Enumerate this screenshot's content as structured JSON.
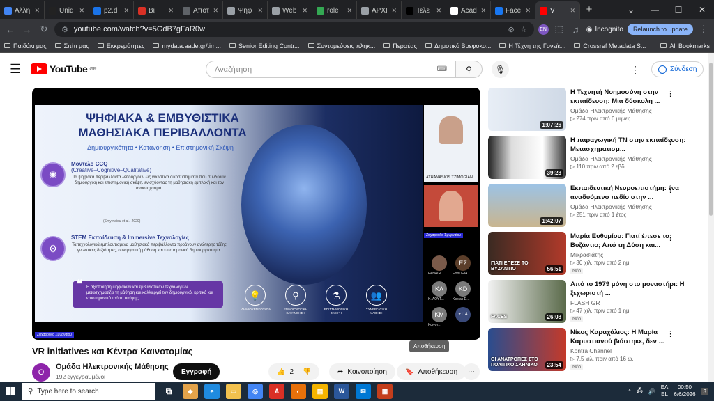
{
  "browser": {
    "tabs": [
      {
        "label": "Αλλη",
        "color": "#4285f4"
      },
      {
        "label": "Uniq",
        "color": "#222222"
      },
      {
        "label": "p2.d",
        "color": "#1a73e8"
      },
      {
        "label": "Βι",
        "color": "#d93025"
      },
      {
        "label": "Αποτ",
        "color": "#5f6368"
      },
      {
        "label": "Ψηφ",
        "color": "#9aa0a6"
      },
      {
        "label": "Web",
        "color": "#9aa0a6"
      },
      {
        "label": "role",
        "color": "#34a853"
      },
      {
        "label": "ΑΡΧΙ",
        "color": "#9aa0a6"
      },
      {
        "label": "Τελε",
        "color": "#000000"
      },
      {
        "label": "Acad",
        "color": "#ffffff"
      },
      {
        "label": "Face",
        "color": "#1877f2"
      },
      {
        "label": "V",
        "color": "#ff0000"
      }
    ],
    "url": "youtube.com/watch?v=5GdB7gFaR0w",
    "profile_badge": "EN",
    "incognito_label": "Incognito",
    "relaunch_label": "Relaunch to update",
    "bookmarks": [
      "Παιδάκι μας",
      "Σπίτι μας",
      "Εκκρεμότητες",
      "mydata.aade.gr/tim...",
      "Senior Editing Contr...",
      "Συντομεύσεις πληκ...",
      "Περσέας",
      "Δημοτικό Βρεφοκο...",
      "Η Τέχνη της Γονεϊκ...",
      "Crossref Metadata S..."
    ],
    "all_bookmarks": "All Bookmarks"
  },
  "youtube": {
    "logo_text": "YouTube",
    "region": "GR",
    "search_placeholder": "Αναζήτηση",
    "signin": "Σύνδεση"
  },
  "slide": {
    "title": "ΨΗΦΙΑΚΑ & ΕΜΒΥΘΙΣΤΙΚΑ ΜΑΘΗΣΙΑΚΑ ΠΕΡΙΒΑΛΛΟΝΤΑ",
    "subtitle": "Δημιουργικότητα • Κατανόηση • Επιστημονική Σκέψη",
    "model_head": "Μοντέλο CCQ",
    "model_sub": "(Creative–Cognitive–Qualitative)",
    "model_text": "Τα ψηφιακά περιβάλλοντα λειτουργούν ως γνωστικά οικοσυστήματα που συνδέουν δημιουργική και επιστημονική σκέψη, ενισχύοντας τη μαθησιακή εμπλοκή και τον αναστοχασμό.",
    "citation": "(Smyrnaiou et al., 2020)",
    "stem_head": "STEM Εκπαίδευση & Immersive Τεχνολογίες",
    "stem_text": "Τα τεχνολογικά εμπλουτισμένα μαθησιακά περιβάλλοντα προάγουν ανώτερης τάξης γνωστικές δεξιότητες, συνεργατική μάθηση και επιστημονική δημιουργικότητα.",
    "quote": "Η αξιοποίηση ψηφιακών και εμβυθιστικών τεχνολογιών μετασχηματίζει τη μάθηση και καλλιεργεί τον δημιουργικό, κριτικό και επιστημονικό τρόπο σκέψης.",
    "icons": [
      "ΔΗΜΙΟΥΡΓΙΚΟΤΗΤΑ",
      "ΕΝΝΟΙΟΛΟΓΙΚΗ ΚΑΤΑΝΟΗΣΗ",
      "ΕΠΙΣΤΗΜΟΝΙΚΗ ΣΚΕΨΗ",
      "ΣΥΝΕΡΓΑΤΙΚΗ ΜΑΘΗΣΗ"
    ],
    "presenter_tag": "Ζαχαρούλα Σμυρναίου"
  },
  "participants": {
    "p1": "ATHANASIOS TZIMOGIAN...",
    "p2": "Ζαχαρούλα Σμυρναίου",
    "avatars": [
      {
        "initials": "ΕΣ",
        "name": "ΕΥΔΟΞΙΑ...",
        "color": "#5b3e2a"
      },
      {
        "initials": "ΚΛ",
        "name": "Κ. ΛΟΥΤ...",
        "color": "#7a7a7a"
      },
      {
        "initials": "KD",
        "name": "Kostas D...",
        "color": "#7a7a7a"
      },
      {
        "initials": "KM",
        "name": "Κωνστ...",
        "color": "#7a7a7a"
      }
    ],
    "panag": "PANAGI...",
    "more": "+114"
  },
  "video": {
    "title": "VR initiatives και Κέντρα Καινοτομίας",
    "channel": "Ομάδα Ηλεκτρονικής Μάθησης",
    "channel_initial": "Ο",
    "subs": "192 εγγεγραμμένοι",
    "subscribe": "Εγγραφή",
    "likes": "2",
    "share": "Κοινοποίηση",
    "save": "Αποθήκευση",
    "tooltip": "Αποθήκευση"
  },
  "recommendations": [
    {
      "title": "Η Τεχνητή Νοημοσύνη στην εκπαίδευση: Μια δύσκολη ...",
      "channel": "Ομάδα Ηλεκτρονικής Μάθησης",
      "meta": "274  πριν από 6 μήνες",
      "duration": "1:07:26",
      "bg": "linear-gradient(90deg,#e8eef6,#cfd9e6)",
      "new": ""
    },
    {
      "title": "Η παραγωγική ΤΝ στην εκπαίδευση: Μετασχηματισμ...",
      "channel": "Ομάδα Ηλεκτρονικής Μάθησης",
      "meta": "110  πριν από 2 εβδ.",
      "duration": "39:28",
      "bg": "linear-gradient(90deg,#222,#ddd 30%,#fff 70%,#333)",
      "new": ""
    },
    {
      "title": "Εκπαιδευτική Νευροεπιστήμη: ένα αναδυόμενο πεδίο στην ...",
      "channel": "Ομάδα Ηλεκτρονικής Μάθησης",
      "meta": "251  πριν από 1 έτος",
      "duration": "1:42:07",
      "bg": "linear-gradient(180deg,#9cc3e6,#c9b58f)",
      "new": ""
    },
    {
      "title": "Μαρία Ευθυμίου: Γιατί έπεσε το Βυζάντιο; Από τη Δύση και...",
      "channel": "Μικρασιάτης",
      "meta": "30 χιλ.  πριν από 2 ημ.",
      "duration": "56:51",
      "bg": "linear-gradient(90deg,#3a2a22,#b23a2a)",
      "caption": "ΓΙΑΤΙ ΕΠΕΣΕ ΤΟ ΒΥΖΑΝΤΙΟ",
      "new": "Νέο"
    },
    {
      "title": "Από το 1979 μόνη στο μοναστήρι: Η ξεχωριστή ...",
      "channel": "FLASH GR",
      "meta": "47 χιλ.  πριν από 1 ημ.",
      "duration": "26:08",
      "bg": "linear-gradient(90deg,#f2f2f2,#5a6a4a)",
      "caption": "FACES",
      "new": "Νέο"
    },
    {
      "title": "Νίκος Καραχάλιος: Η Μαρία Καρυστιανού βιάστηκε, δεν ...",
      "channel": "Kontra Channel",
      "meta": "7,5 χιλ.  πριν από 16 ώ.",
      "duration": "23:54",
      "bg": "linear-gradient(90deg,#2a4d8f,#c43a2a)",
      "caption": "ΟΙ ΑΝΑΤΡΟΠΕΣ ΣΤΟ ΠΟΛΙΤΙΚΟ ΣΚΗΝΙΚΟ",
      "new": "Νέο"
    }
  ],
  "taskbar": {
    "search": "Type here to search",
    "lang1": "ΕΛ",
    "lang2": "EL",
    "time": "00:50",
    "date": "6/6/2026",
    "notif": "3"
  }
}
